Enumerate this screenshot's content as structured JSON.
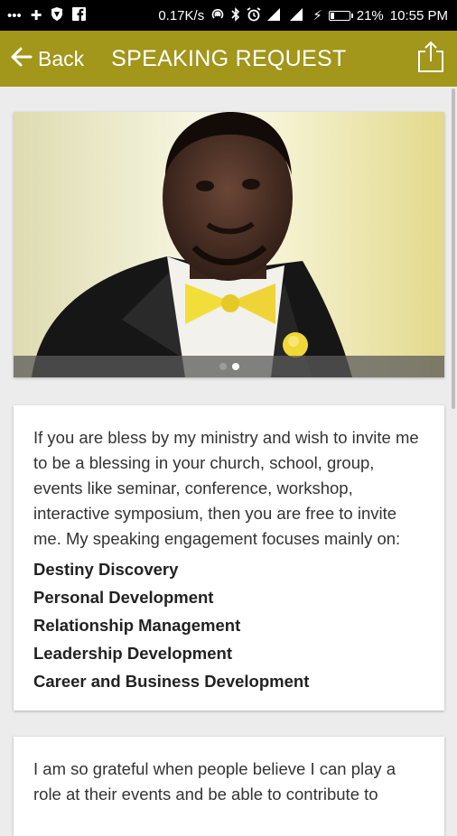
{
  "statusbar": {
    "network_speed": "0.17K/s",
    "battery": "21%",
    "battery_level": 0.21,
    "time": "10:55 PM"
  },
  "appbar": {
    "back_label": "Back",
    "title": "SPEAKING REQUEST",
    "accent_color": "#a2961b"
  },
  "carousel": {
    "slide_count": 2,
    "active_index": 1
  },
  "intro": {
    "paragraph": "If you are bless by my ministry and wish to invite me to be a blessing in your church, school, group, events like seminar, conference, workshop, interactive symposium, then you are free to invite me. My speaking engagement focuses mainly on:",
    "topics": [
      "Destiny Discovery",
      "Personal Development",
      "Relationship Management",
      "Leadership Development",
      "Career and Business Development"
    ]
  },
  "second": {
    "paragraph": "I am so grateful when people believe I can play a role at their events and be able to contribute to"
  }
}
